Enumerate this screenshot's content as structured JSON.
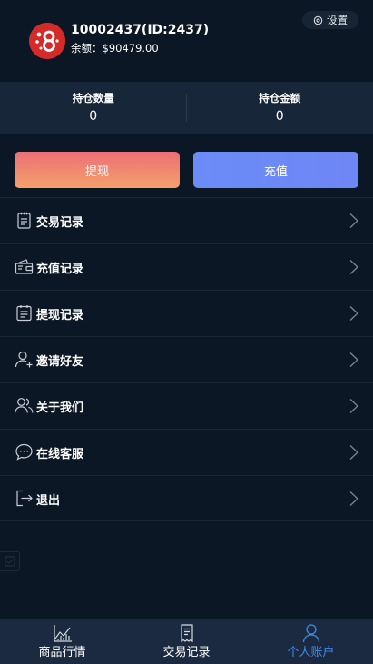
{
  "user": {
    "name": "10002437(ID:2437)",
    "balance_label": "余额：",
    "balance_value": "$90479.00"
  },
  "settings": {
    "label": "设置"
  },
  "stats": {
    "position_count_label": "持仓数量",
    "position_count_value": "0",
    "position_amount_label": "持仓金额",
    "position_amount_value": "0"
  },
  "actions": {
    "withdraw_label": "提现",
    "recharge_label": "充值"
  },
  "menu": {
    "items": [
      {
        "label": "交易记录",
        "icon": "clipboard-icon"
      },
      {
        "label": "充值记录",
        "icon": "wallet-icon"
      },
      {
        "label": "提现记录",
        "icon": "list-icon"
      },
      {
        "label": "邀请好友",
        "icon": "user-add-icon"
      },
      {
        "label": "关于我们",
        "icon": "users-icon"
      },
      {
        "label": "在线客服",
        "icon": "chat-icon"
      },
      {
        "label": "退出",
        "icon": "logout-icon"
      }
    ]
  },
  "tabbar": {
    "tabs": [
      {
        "label": "商品行情",
        "icon": "chart-icon"
      },
      {
        "label": "交易记录",
        "icon": "receipt-icon"
      },
      {
        "label": "个人账户",
        "icon": "person-icon"
      }
    ],
    "active_index": 2
  },
  "colors": {
    "background": "#0c1725",
    "stats_background": "#18263a",
    "tabbar_background": "#1b2a40",
    "active_tab": "#3d8de8",
    "withdraw_gradient_start": "#ec6f77",
    "withdraw_gradient_end": "#f3a06a",
    "recharge": "#6f86f5",
    "avatar": "#d42a2a"
  }
}
